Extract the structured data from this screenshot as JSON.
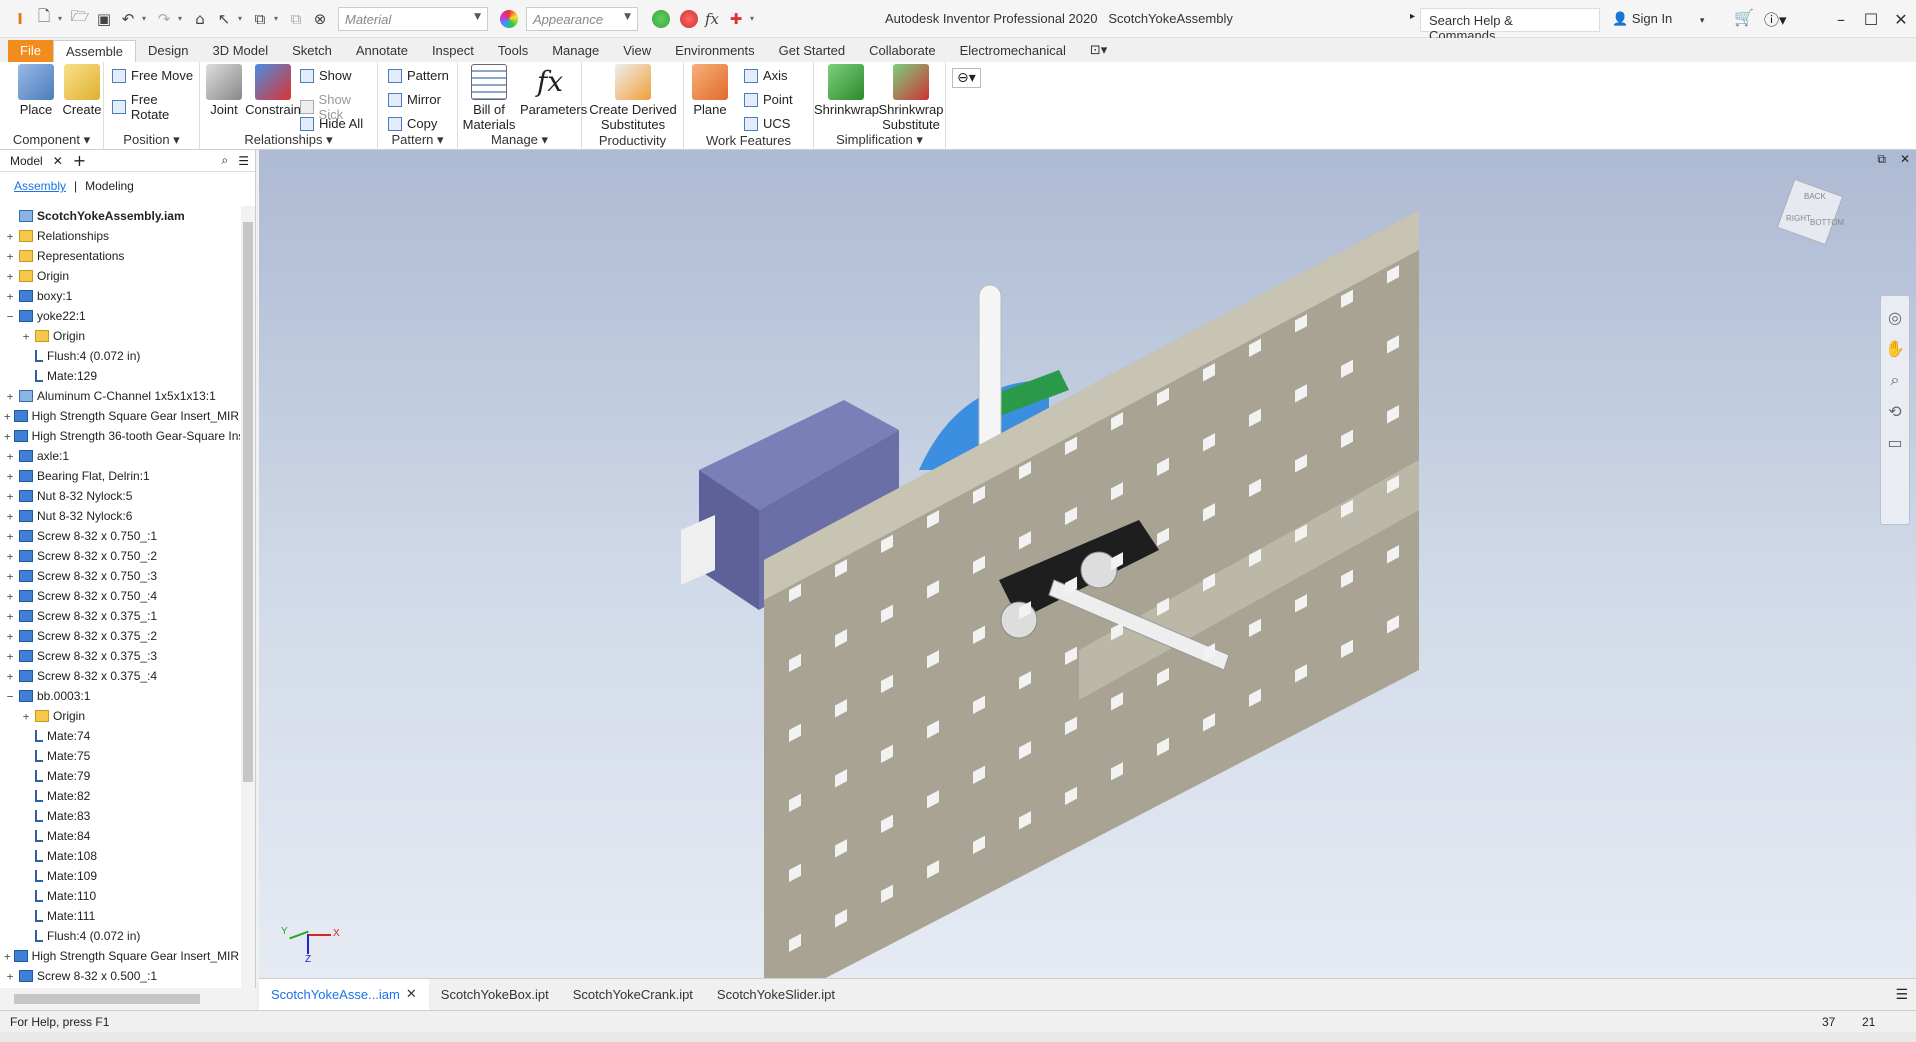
{
  "titlebar": {
    "app_title": "Autodesk Inventor Professional 2020",
    "doc_title": "ScotchYokeAssembly",
    "material_placeholder": "Material",
    "appearance_placeholder": "Appearance",
    "search": "Search Help & Commands...",
    "sign_in": "Sign In"
  },
  "menu_tabs": [
    "File",
    "Assemble",
    "Design",
    "3D Model",
    "Sketch",
    "Annotate",
    "Inspect",
    "Tools",
    "Manage",
    "View",
    "Environments",
    "Get Started",
    "Collaborate",
    "Electromechanical"
  ],
  "ribbon": {
    "component": {
      "place": "Place",
      "create": "Create",
      "footer": "Component"
    },
    "position": {
      "free_move": "Free Move",
      "free_rotate": "Free Rotate",
      "footer": "Position"
    },
    "relationships": {
      "joint": "Joint",
      "constrain": "Constrain",
      "show": "Show",
      "show_sick": "Show Sick",
      "hide_all": "Hide All",
      "footer": "Relationships"
    },
    "pattern": {
      "pattern": "Pattern",
      "mirror": "Mirror",
      "copy": "Copy",
      "footer": "Pattern"
    },
    "manage": {
      "bom": "Bill of Materials",
      "parameters": "Parameters",
      "footer": "Manage"
    },
    "productivity": {
      "create_derived": "Create Derived Substitutes",
      "footer": "Productivity"
    },
    "work_features": {
      "plane": "Plane",
      "axis": "Axis",
      "point": "Point",
      "ucs": "UCS",
      "footer": "Work Features"
    },
    "simplification": {
      "shrinkwrap": "Shrinkwrap",
      "shrinkwrap_sub": "Shrinkwrap Substitute",
      "footer": "Simplification"
    }
  },
  "browser": {
    "title": "Model",
    "tab_assembly": "Assembly",
    "tab_modeling": "Modeling",
    "rows": [
      {
        "label": "ScotchYokeAssembly.iam",
        "pm": "",
        "icon": "asm",
        "indent": 0,
        "root": true
      },
      {
        "label": "Relationships",
        "pm": "+",
        "icon": "fold",
        "indent": 0
      },
      {
        "label": "Representations",
        "pm": "+",
        "icon": "fold",
        "indent": 0
      },
      {
        "label": "Origin",
        "pm": "+",
        "icon": "fold",
        "indent": 0
      },
      {
        "label": "boxy:1",
        "pm": "+",
        "icon": "part",
        "indent": 0
      },
      {
        "label": "yoke22:1",
        "pm": "−",
        "icon": "part",
        "indent": 0
      },
      {
        "label": "Origin",
        "pm": "+",
        "icon": "fold",
        "indent": 1
      },
      {
        "label": "Flush:4 (0.072 in)",
        "pm": "",
        "icon": "cons",
        "indent": 1
      },
      {
        "label": "Mate:129",
        "pm": "",
        "icon": "cons",
        "indent": 1
      },
      {
        "label": "Aluminum C-Channel 1x5x1x13:1",
        "pm": "+",
        "icon": "asm",
        "indent": 0
      },
      {
        "label": "High Strength Square Gear Insert_MIR:",
        "pm": "+",
        "icon": "part",
        "indent": 0
      },
      {
        "label": "High Strength 36-tooth Gear-Square Ins",
        "pm": "+",
        "icon": "part",
        "indent": 0
      },
      {
        "label": "axle:1",
        "pm": "+",
        "icon": "part",
        "indent": 0
      },
      {
        "label": "Bearing Flat, Delrin:1",
        "pm": "+",
        "icon": "part",
        "indent": 0
      },
      {
        "label": "Nut 8-32 Nylock:5",
        "pm": "+",
        "icon": "part",
        "indent": 0
      },
      {
        "label": "Nut 8-32 Nylock:6",
        "pm": "+",
        "icon": "part",
        "indent": 0
      },
      {
        "label": "Screw 8-32 x 0.750_:1",
        "pm": "+",
        "icon": "part",
        "indent": 0
      },
      {
        "label": "Screw 8-32 x 0.750_:2",
        "pm": "+",
        "icon": "part",
        "indent": 0
      },
      {
        "label": "Screw 8-32 x 0.750_:3",
        "pm": "+",
        "icon": "part",
        "indent": 0
      },
      {
        "label": "Screw 8-32 x 0.750_:4",
        "pm": "+",
        "icon": "part",
        "indent": 0
      },
      {
        "label": "Screw 8-32 x 0.375_:1",
        "pm": "+",
        "icon": "part",
        "indent": 0
      },
      {
        "label": "Screw 8-32 x 0.375_:2",
        "pm": "+",
        "icon": "part",
        "indent": 0
      },
      {
        "label": "Screw 8-32 x 0.375_:3",
        "pm": "+",
        "icon": "part",
        "indent": 0
      },
      {
        "label": "Screw 8-32 x 0.375_:4",
        "pm": "+",
        "icon": "part",
        "indent": 0
      },
      {
        "label": "bb.0003:1",
        "pm": "−",
        "icon": "part",
        "indent": 0
      },
      {
        "label": "Origin",
        "pm": "+",
        "icon": "fold",
        "indent": 1
      },
      {
        "label": "Mate:74",
        "pm": "",
        "icon": "cons",
        "indent": 1
      },
      {
        "label": "Mate:75",
        "pm": "",
        "icon": "cons",
        "indent": 1
      },
      {
        "label": "Mate:79",
        "pm": "",
        "icon": "cons",
        "indent": 1
      },
      {
        "label": "Mate:82",
        "pm": "",
        "icon": "cons",
        "indent": 1
      },
      {
        "label": "Mate:83",
        "pm": "",
        "icon": "cons",
        "indent": 1
      },
      {
        "label": "Mate:84",
        "pm": "",
        "icon": "cons",
        "indent": 1
      },
      {
        "label": "Mate:108",
        "pm": "",
        "icon": "cons",
        "indent": 1
      },
      {
        "label": "Mate:109",
        "pm": "",
        "icon": "cons",
        "indent": 1
      },
      {
        "label": "Mate:110",
        "pm": "",
        "icon": "cons",
        "indent": 1
      },
      {
        "label": "Mate:111",
        "pm": "",
        "icon": "cons",
        "indent": 1
      },
      {
        "label": "Flush:4 (0.072 in)",
        "pm": "",
        "icon": "cons",
        "indent": 1
      },
      {
        "label": "High Strength Square Gear Insert_MIR:",
        "pm": "+",
        "icon": "part",
        "indent": 0
      },
      {
        "label": "Screw 8-32 x 0.500_:1",
        "pm": "+",
        "icon": "part",
        "indent": 0
      }
    ]
  },
  "doc_tabs": [
    "ScotchYokeAsse...iam",
    "ScotchYokeBox.ipt",
    "ScotchYokeCrank.ipt",
    "ScotchYokeSlider.ipt"
  ],
  "viewcube": {
    "top": "BACK",
    "left": "RIGHT",
    "right": "BOTTOM"
  },
  "triad": {
    "x": "X",
    "y": "Y",
    "z": "Z"
  },
  "status": {
    "help": "For Help, press F1",
    "count1": "37",
    "count2": "21"
  }
}
